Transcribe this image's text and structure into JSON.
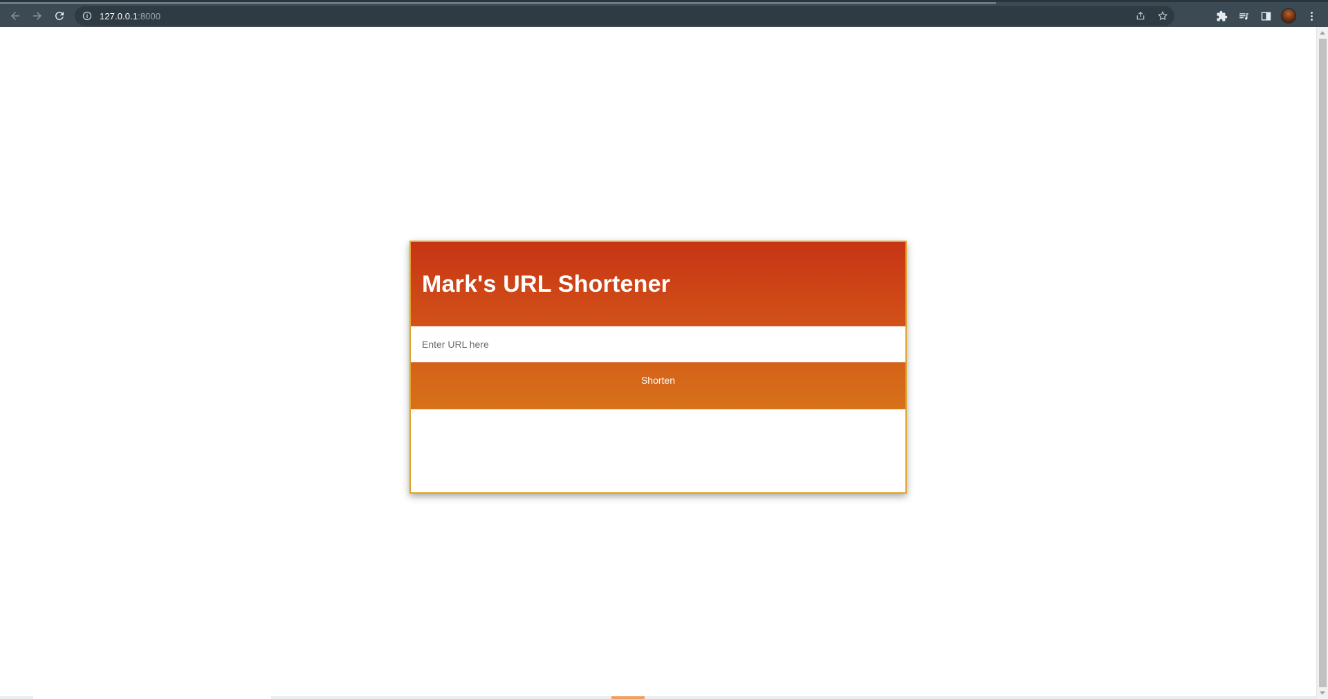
{
  "browser": {
    "url_host": "127.0.0.1",
    "url_port": ":8000"
  },
  "icons": {
    "back": "back-arrow-icon",
    "forward": "forward-arrow-icon",
    "reload": "reload-icon",
    "info": "info-icon",
    "share": "share-icon",
    "bookmark": "star-icon",
    "extensions": "puzzle-icon",
    "media": "media-queue-icon",
    "side_panel": "side-panel-icon",
    "menu": "more-vert-icon"
  },
  "app": {
    "title": "Mark's URL Shortener",
    "url_input": {
      "value": "",
      "placeholder": "Enter URL here"
    },
    "shorten_label": "Shorten"
  },
  "colors": {
    "header_top": "#c73415",
    "header_bottom": "#d25218",
    "button": "#d5661a",
    "card_border": "#e0a52a",
    "browser_chrome": "#3c4a54"
  }
}
